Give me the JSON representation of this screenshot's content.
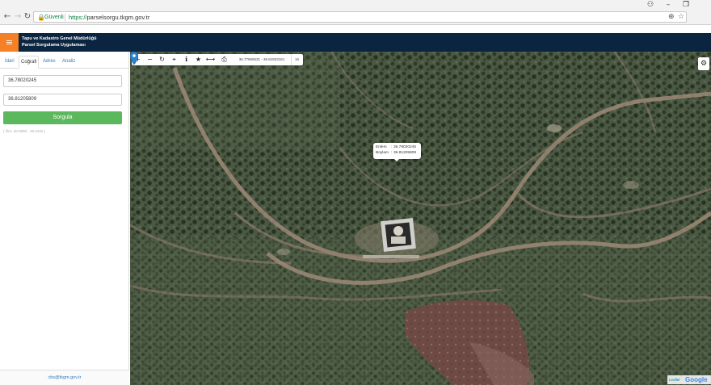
{
  "browser": {
    "secure_label": "Güvenli",
    "url_scheme": "https://",
    "url_host": "parselsorgu.tkgm.gov.tr"
  },
  "app": {
    "title_line1": "Tapu ve Kadastro Genel Müdürlüğü",
    "title_line2": "Parsel Sorgulama Uygulaması"
  },
  "sidebar": {
    "tabs": [
      {
        "label": "İdari"
      },
      {
        "label": "Coğrafi"
      },
      {
        "label": "Adres"
      },
      {
        "label": "Analiz"
      }
    ],
    "active_tab": "Coğrafi",
    "latitude_value": "36.78020245",
    "longitude_value": "36.81205809",
    "query_button": "Sorgula",
    "hint": "( Örn: 40.0606 - 26.2192 )",
    "footer_email": "cbs@tkgm.gov.tr"
  },
  "map": {
    "toolbar_coords": "36.77965531 - 36.81823161",
    "toolbar_zoom": "16",
    "popup": {
      "lat_label": "Enlem",
      "lat_value": "36.78020245",
      "lon_label": "Boylam",
      "lon_value": "36.81205809"
    },
    "attribution_leaflet": "Leaflet",
    "attribution_google": "Google"
  },
  "colors": {
    "header_bg": "#0b2440",
    "menu_accent": "#f58025",
    "button_green": "#5cb85c",
    "pin_blue": "#2b82cb"
  }
}
